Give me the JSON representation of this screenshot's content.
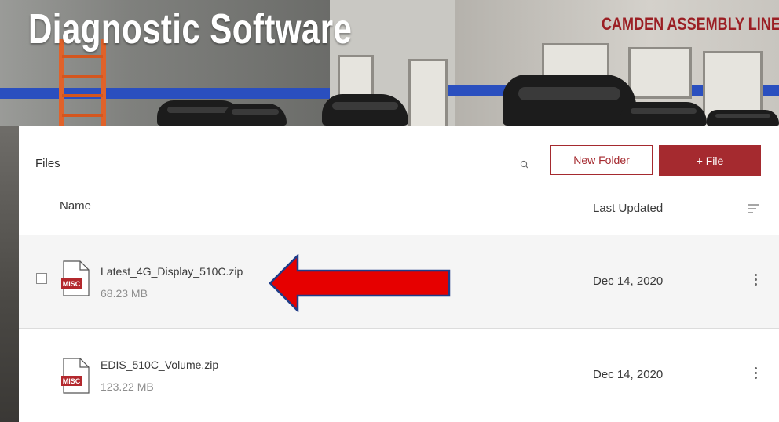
{
  "hero": {
    "title": "Diagnostic Software",
    "banner": "CAMDEN ASSEMBLY LINE"
  },
  "toolbar": {
    "section_label": "Files",
    "search_icon": "search-icon",
    "new_folder_label": "New Folder",
    "add_file_label": "+ File"
  },
  "table": {
    "columns": {
      "name": "Name",
      "last_updated": "Last Updated"
    },
    "sort_icon": "sort-lines-icon",
    "rows": [
      {
        "name": "Latest_4G_Display_510C.zip",
        "size": "68.23 MB",
        "date": "Dec 14, 2020",
        "type_badge": "MISC",
        "highlighted": true
      },
      {
        "name": "EDIS_510C_Volume.zip",
        "size": "123.22 MB",
        "date": "Dec 14, 2020",
        "type_badge": "MISC",
        "highlighted": false
      }
    ]
  },
  "colors": {
    "accent": "#a52a2f",
    "annotation_arrow_fill": "#e60000",
    "annotation_arrow_stroke": "#1f3c88"
  }
}
